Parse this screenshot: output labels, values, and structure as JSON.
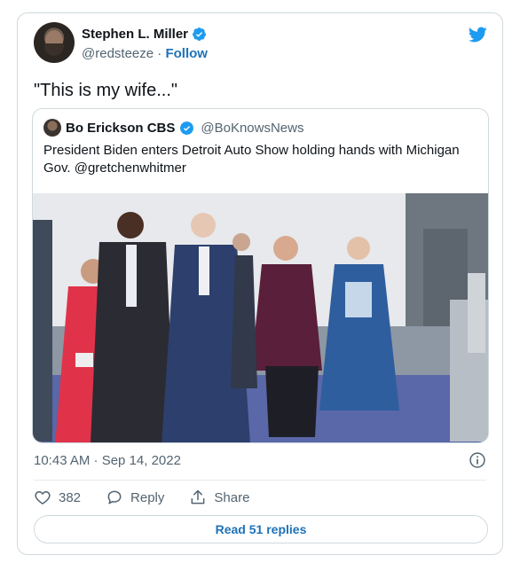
{
  "author": {
    "name": "Stephen L. Miller",
    "handle": "@redsteeze",
    "separator": "·",
    "follow_label": "Follow"
  },
  "tweet": {
    "text": "\"This is my wife...\"",
    "timestamp": "10:43 AM · Sep 14, 2022"
  },
  "quoted": {
    "name": "Bo Erickson CBS",
    "handle": "@BoKnowsNews",
    "text": "President Biden enters Detroit Auto Show holding hands with Michigan Gov. @gretchenwhitmer"
  },
  "actions": {
    "like_count": "382",
    "reply_label": "Reply",
    "share_label": "Share",
    "read_replies_label": "Read 51 replies"
  },
  "colors": {
    "accent": "#1d9bf0",
    "link": "#1d72b8",
    "muted": "#536471",
    "border": "#cfd9de"
  },
  "icons": [
    "verified-badge-icon",
    "twitter-bird-icon",
    "info-icon",
    "heart-icon",
    "reply-icon",
    "share-icon"
  ]
}
